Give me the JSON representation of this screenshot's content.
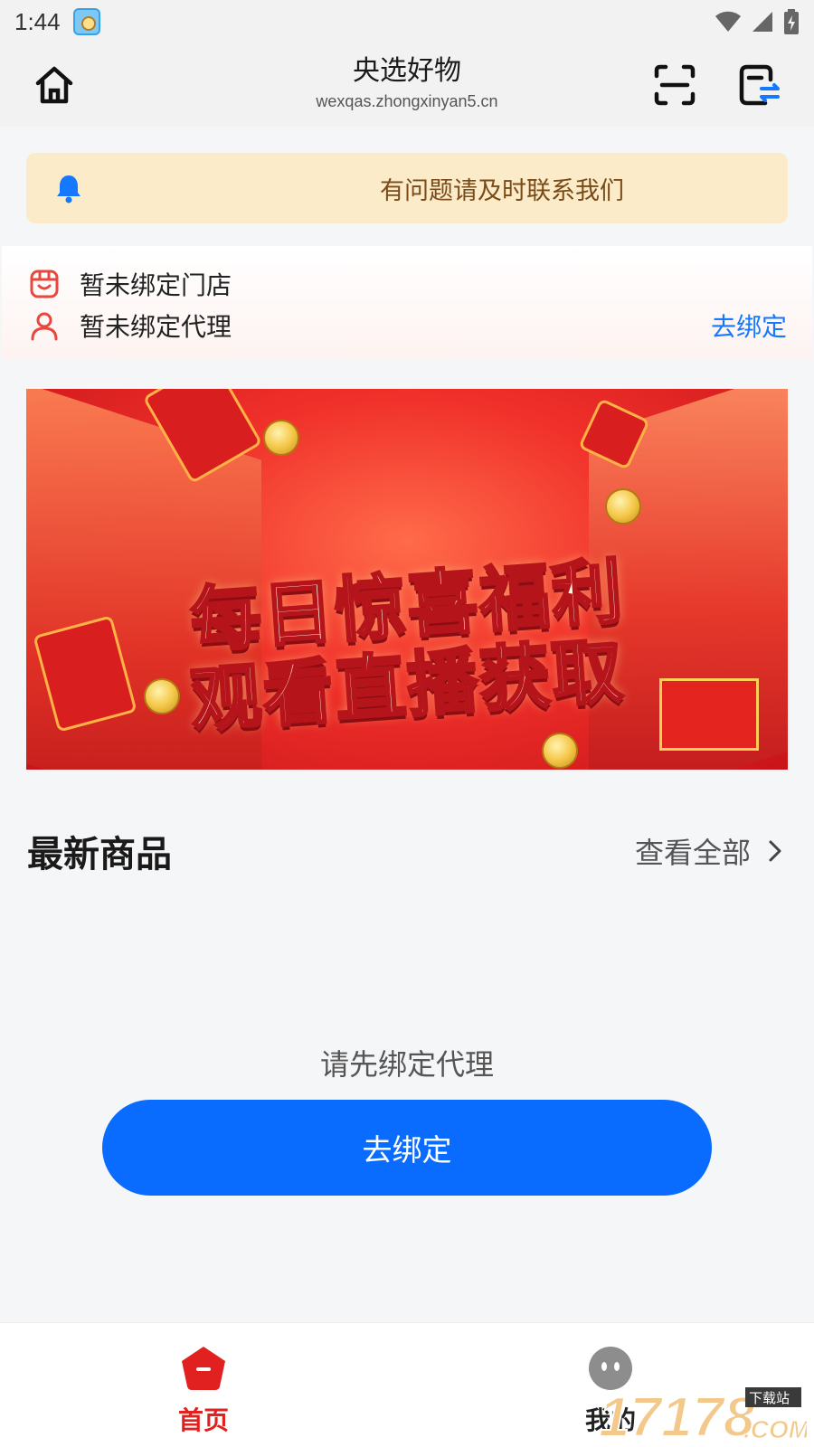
{
  "status_bar": {
    "time": "1:44",
    "app_icon": "app-notification-icon",
    "wifi_icon": "wifi-icon",
    "signal_icon": "signal-icon",
    "battery_icon": "battery-charging-icon"
  },
  "toolbar": {
    "title": "央选好物",
    "url": "wexqas.zhongxinyan5.cn",
    "home_icon": "home-icon",
    "scan_icon": "scan-icon",
    "switch_icon": "switch-account-icon"
  },
  "notice": {
    "text": "有问题请及时联系我们",
    "icon": "bell-icon",
    "bg_color": "#fcebc9"
  },
  "binding": {
    "store_status": "暂未绑定门店",
    "agent_status": "暂未绑定代理",
    "bind_link": "去绑定",
    "link_color": "#1677ff"
  },
  "banner": {
    "line1": "每日惊喜福利",
    "line2": "观看直播获取"
  },
  "products": {
    "section_title": "最新商品",
    "view_all": "查看全部",
    "empty_message": "请先绑定代理",
    "bind_button": "去绑定",
    "button_color": "#0a6cff"
  },
  "bottom_nav": {
    "items": [
      {
        "label": "首页",
        "icon": "home-tab-icon",
        "active": true
      },
      {
        "label": "我的",
        "icon": "profile-tab-icon",
        "active": false
      }
    ],
    "active_color": "#e0211f"
  },
  "watermark": {
    "text": "17178",
    "sub_text": "下载站",
    "domain": ".COM"
  }
}
